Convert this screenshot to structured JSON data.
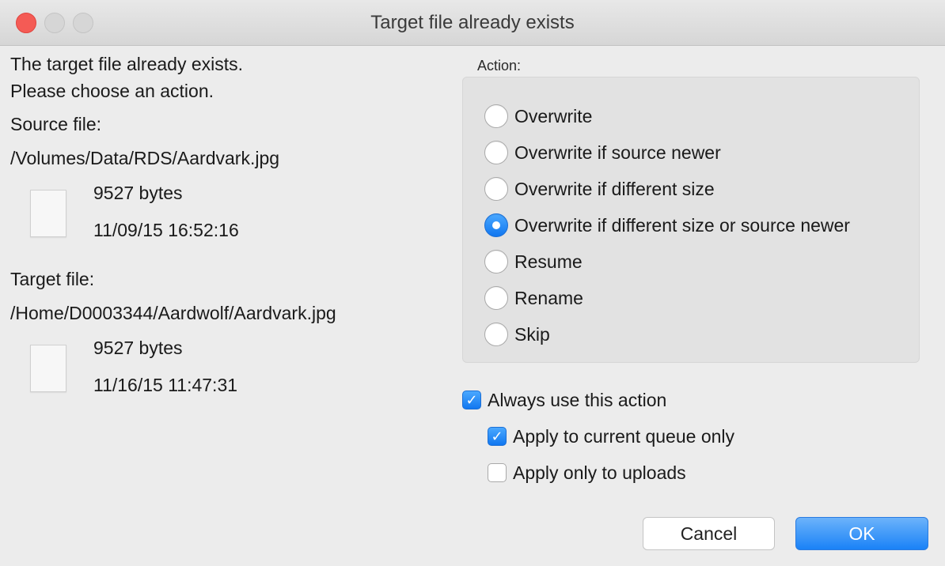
{
  "window": {
    "title": "Target file already exists"
  },
  "message": {
    "line1": "The target file already exists.",
    "line2": "Please choose an action."
  },
  "source": {
    "label": "Source file:",
    "path": "/Volumes/Data/RDS/Aardvark.jpg",
    "size": "9527 bytes",
    "date": "11/09/15 16:52:16"
  },
  "target": {
    "label": "Target file:",
    "path": "/Home/D0003344/Aardwolf/Aardvark.jpg",
    "size": "9527 bytes",
    "date": "11/16/15 11:47:31"
  },
  "actions": {
    "label": "Action:",
    "options": [
      {
        "label": "Overwrite",
        "selected": false
      },
      {
        "label": "Overwrite if source newer",
        "selected": false
      },
      {
        "label": "Overwrite if different size",
        "selected": false
      },
      {
        "label": "Overwrite if different size or source newer",
        "selected": true
      },
      {
        "label": "Resume",
        "selected": false
      },
      {
        "label": "Rename",
        "selected": false
      },
      {
        "label": "Skip",
        "selected": false
      }
    ]
  },
  "options": {
    "always": {
      "label": "Always use this action",
      "checked": true
    },
    "queue_only": {
      "label": "Apply to current queue only",
      "checked": true
    },
    "uploads_only": {
      "label": "Apply only to uploads",
      "checked": false
    }
  },
  "buttons": {
    "cancel": "Cancel",
    "ok": "OK"
  },
  "colors": {
    "accent": "#1a82f7",
    "close": "#f45b55"
  },
  "icons": {
    "check": "✓"
  }
}
